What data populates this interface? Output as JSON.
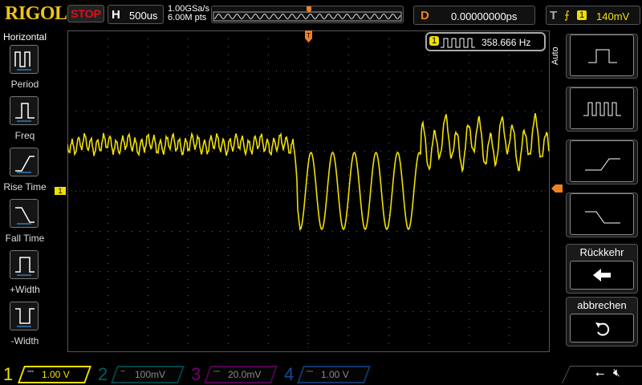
{
  "header": {
    "logo": "RIGOL",
    "run_state": "STOP",
    "horizontal_label": "H",
    "timebase": "500us",
    "sample_rate": "1.00GSa/s",
    "memory_depth": "6.00M pts",
    "delay_label": "D",
    "delay": "0.00000000ps",
    "trigger_label": "T",
    "trigger_slope": "rising",
    "trigger_source": "1",
    "trigger_level": "140mV"
  },
  "measurement": {
    "channel": "1",
    "value": "358.666 Hz"
  },
  "left_menu": {
    "title": "Horizontal",
    "items": [
      {
        "label": "Period",
        "icon": "period-icon"
      },
      {
        "label": "Freq",
        "icon": "frequency-icon"
      },
      {
        "label": "Rise Time",
        "icon": "rise-time-icon"
      },
      {
        "label": "Fall Time",
        "icon": "fall-time-icon"
      },
      {
        "label": "+Width",
        "icon": "positive-width-icon"
      },
      {
        "label": "-Width",
        "icon": "negative-width-icon"
      }
    ]
  },
  "right_menu": {
    "mode": "Auto",
    "back_label": "Rückkehr",
    "cancel_label": "abbrechen"
  },
  "channels": [
    {
      "num": "1",
      "coupling": "DC",
      "scale": "1.00 V",
      "color": "#f0e000",
      "active": true
    },
    {
      "num": "2",
      "coupling": "AC",
      "scale": "100mV",
      "color": "#00a0a0",
      "active": false
    },
    {
      "num": "3",
      "coupling": "DC",
      "scale": "20.0mV",
      "color": "#c000c0",
      "active": false
    },
    {
      "num": "4",
      "coupling": "DC",
      "scale": "1.00 V",
      "color": "#2080ff",
      "active": false
    }
  ],
  "colors": {
    "ch1": "#f0e000",
    "trigger": "#f08020",
    "stop": "#e0101a"
  }
}
